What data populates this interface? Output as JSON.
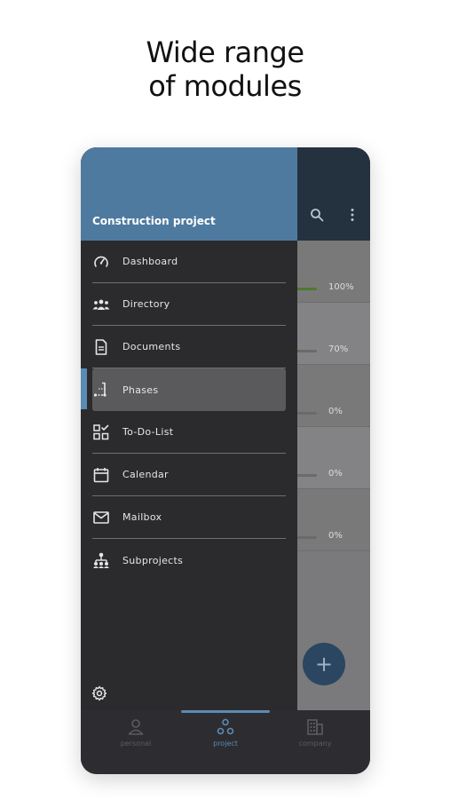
{
  "headline": {
    "line1": "Wide range",
    "line2": "of modules"
  },
  "drawer": {
    "title": "Construction project",
    "items": [
      {
        "label": "Dashboard",
        "icon": "dashboard-gauge-icon"
      },
      {
        "label": "Directory",
        "icon": "people-group-icon"
      },
      {
        "label": "Documents",
        "icon": "document-icon"
      },
      {
        "label": "Phases",
        "icon": "phases-steps-icon",
        "active": true
      },
      {
        "label": "To-Do-List",
        "icon": "todo-grid-check-icon"
      },
      {
        "label": "Calendar",
        "icon": "calendar-icon"
      },
      {
        "label": "Mailbox",
        "icon": "mail-icon"
      },
      {
        "label": "Subprojects",
        "icon": "subprojects-hierarchy-icon"
      }
    ]
  },
  "phases": [
    {
      "percent": "100%",
      "progress": 1.0
    },
    {
      "percent": "70%",
      "progress": 0.7
    },
    {
      "percent": "0%",
      "progress": 0
    },
    {
      "percent": "0%",
      "progress": 0
    },
    {
      "percent": "0%",
      "progress": 0
    }
  ],
  "fab": {
    "label": "+"
  },
  "bottom_nav": {
    "items": [
      {
        "label": "personal",
        "icon": "person-icon"
      },
      {
        "label": "project",
        "icon": "project-nodes-icon",
        "active": true
      },
      {
        "label": "company",
        "icon": "building-icon"
      }
    ]
  },
  "colors": {
    "accent": "#5b8ab3",
    "drawer_header": "#4f7aa0",
    "drawer_bg": "#2b2b2e",
    "progress_green": "#4c7a2e"
  }
}
